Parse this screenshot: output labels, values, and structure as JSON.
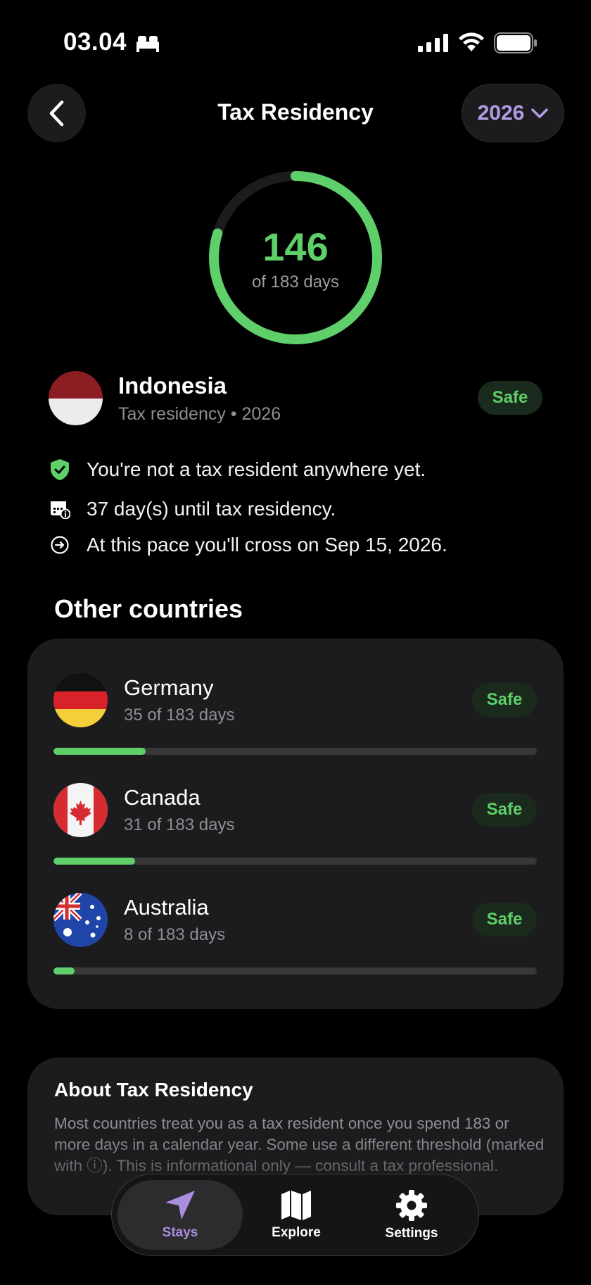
{
  "status_bar": {
    "time": "03.04"
  },
  "header": {
    "title": "Tax Residency",
    "year": "2026"
  },
  "progress_ring": {
    "value": "146",
    "label": "of 183 days",
    "fraction": 0.798,
    "color": "#5fcf6a"
  },
  "main_country": {
    "name": "Indonesia",
    "subtitle": "Tax residency • 2026",
    "badge": "Safe",
    "facts": [
      {
        "icon": "shield-check-icon",
        "text": "You're not a tax resident anywhere yet."
      },
      {
        "icon": "calendar-info-icon",
        "text": "37 day(s) until tax residency."
      },
      {
        "icon": "arrow-circle-icon",
        "text": "At this pace you'll cross on Sep 15, 2026."
      }
    ]
  },
  "other_countries": {
    "title": "Other countries",
    "items": [
      {
        "name": "Germany",
        "days": "35 of 183 days",
        "badge": "Safe",
        "fraction": 0.191
      },
      {
        "name": "Canada",
        "days": "31 of 183 days",
        "badge": "Safe",
        "fraction": 0.169
      },
      {
        "name": "Australia",
        "days": "8 of 183 days",
        "badge": "Safe",
        "fraction": 0.044
      }
    ]
  },
  "about": {
    "title": "About Tax Residency",
    "body": "Most countries treat you as a tax resident once you spend 183 or more days in a calendar year. Some use a different threshold (marked with ⓘ). This is informational only — consult a tax professional."
  },
  "tabbar": {
    "tabs": [
      {
        "label": "Stays",
        "icon": "navigation-arrow-icon",
        "active": true
      },
      {
        "label": "Explore",
        "icon": "map-icon",
        "active": false
      },
      {
        "label": "Settings",
        "icon": "gear-icon",
        "active": false
      }
    ]
  },
  "colors": {
    "accent_green": "#5fcf6a",
    "accent_purple": "#b49ae6",
    "card_bg": "#1c1c1e"
  }
}
